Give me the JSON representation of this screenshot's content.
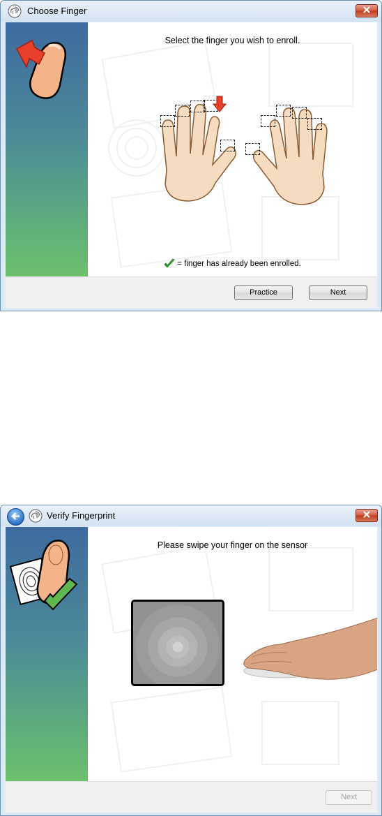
{
  "window1": {
    "title": "Choose Finger",
    "heading": "Select the finger you wish to enroll.",
    "legend_text": "= finger has already been enrolled.",
    "buttons": {
      "practice": "Practice",
      "next": "Next"
    }
  },
  "window2": {
    "title": "Verify Fingerprint",
    "heading": "Please swipe your finger on the sensor",
    "buttons": {
      "next": "Next"
    }
  },
  "colors": {
    "sidebar_top": "#3e6a9e",
    "sidebar_bottom": "#6cc06c",
    "arrow_red": "#e8402a",
    "check_green": "#2fa52f"
  },
  "icons": [
    "fingerprint-icon",
    "close-icon",
    "back-arrow-icon",
    "checkmark-icon",
    "down-arrow-icon"
  ]
}
